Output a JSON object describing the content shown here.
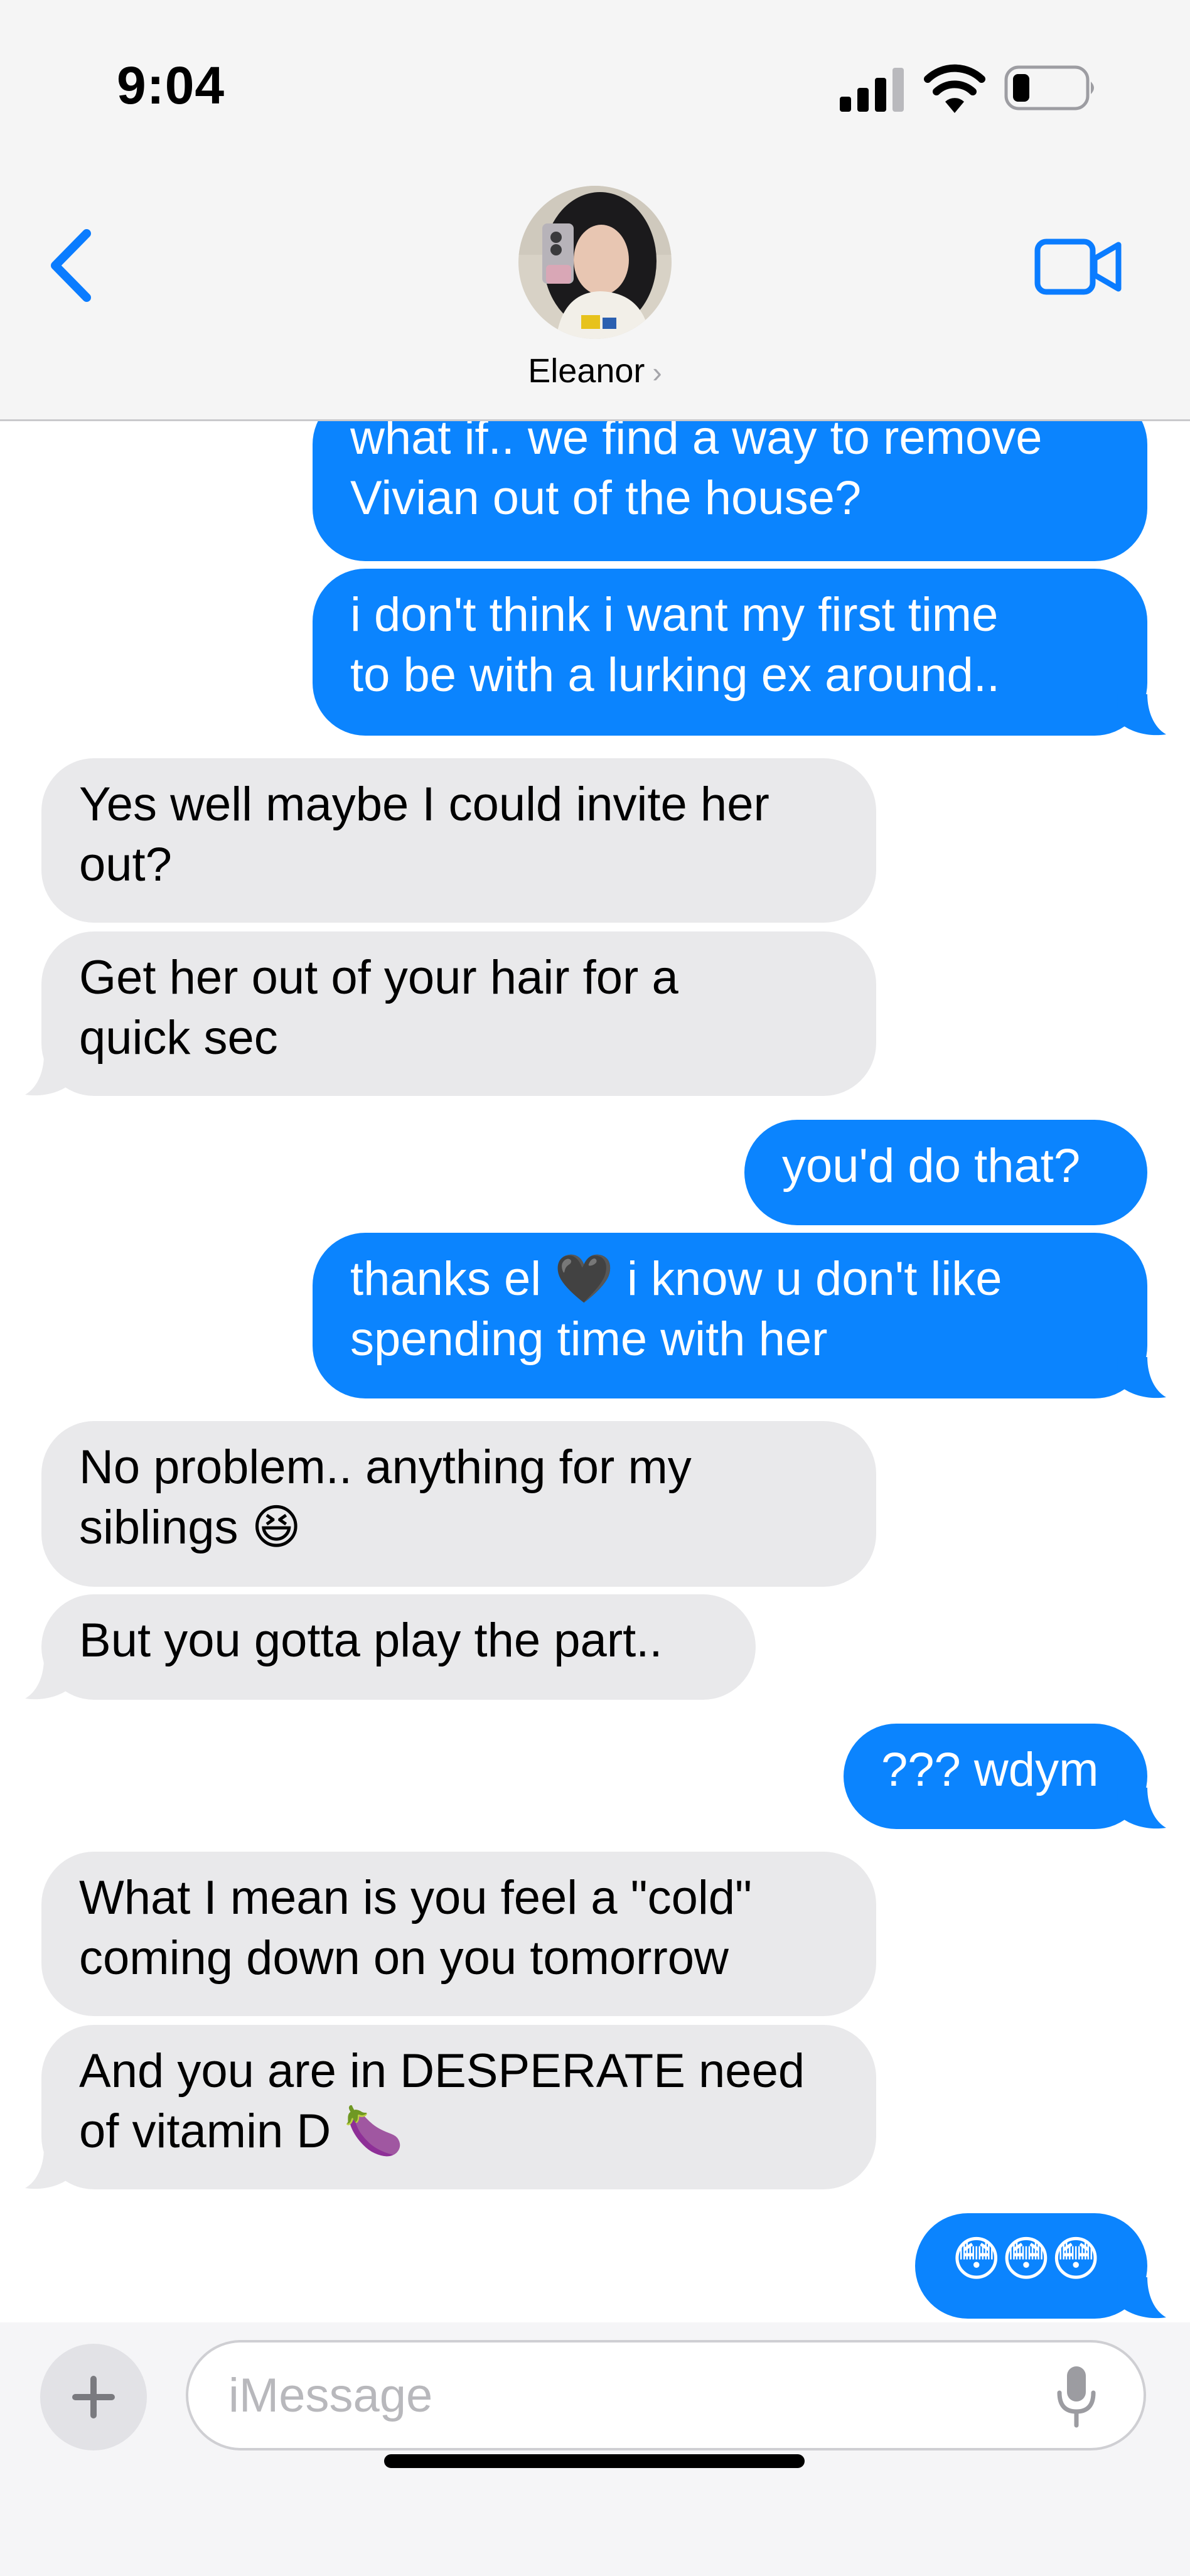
{
  "status_bar": {
    "time": "9:04"
  },
  "header": {
    "contact_name": "Eleanor",
    "chevron": "›"
  },
  "colors": {
    "outgoing": "#0b84fe",
    "incoming": "#e9e9eb",
    "accent": "#0a7cff"
  },
  "messages": [
    {
      "dir": "out",
      "text": "what if.. we find a way to remove\nVivian out of the house?"
    },
    {
      "dir": "out",
      "text": "i don't think i want my first time\nto be with a lurking ex around.."
    },
    {
      "dir": "in",
      "text": "Yes well maybe I could invite her\nout?"
    },
    {
      "dir": "in",
      "text": "Get her out of your hair for a\nquick sec"
    },
    {
      "dir": "out",
      "text": "you'd do that?"
    },
    {
      "dir": "out",
      "text": "thanks el 🖤 i know u don't like\nspending time with her"
    },
    {
      "dir": "in",
      "text": "No problem.. anything for my\nsiblings 😆"
    },
    {
      "dir": "in",
      "text": "But you gotta play the part.."
    },
    {
      "dir": "out",
      "text": "??? wdym"
    },
    {
      "dir": "in",
      "text": "What I mean is you feel a \"cold\"\ncoming down on you tomorrow"
    },
    {
      "dir": "in",
      "text": "And you are in DESPERATE need\nof vitamin D 🍆"
    },
    {
      "dir": "out",
      "text": "😳😳😳"
    }
  ],
  "composer": {
    "placeholder": "iMessage"
  },
  "icons": {
    "back": "chevron-left-icon",
    "video": "video-camera-icon",
    "plus": "plus-icon",
    "mic": "microphone-icon",
    "signal": "cellular-signal-icon",
    "wifi": "wifi-icon",
    "battery": "battery-icon"
  }
}
